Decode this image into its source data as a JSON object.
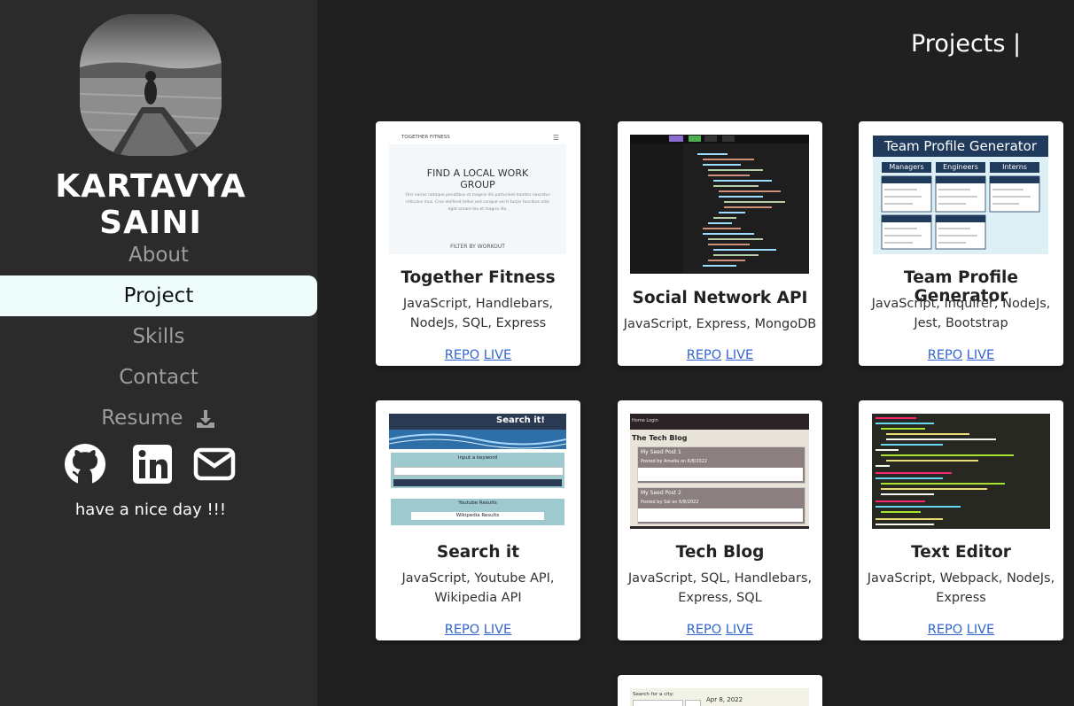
{
  "profile": {
    "name": "KARTAVYA SAINI",
    "tagline": "have a nice day !!!"
  },
  "nav": {
    "items": [
      "About",
      "Project",
      "Skills",
      "Contact",
      "Resume"
    ],
    "active_index": 1
  },
  "socials": [
    "github-icon",
    "linkedin-icon",
    "email-icon"
  ],
  "page": {
    "title": "Projects |"
  },
  "projects": [
    {
      "title": "Together Fitness",
      "tech": "JavaScript, Handlebars, NodeJs, SQL, Express",
      "repo": "REPO",
      "live": "LIVE",
      "thumb": {
        "brand": "TOGETHER FITNESS",
        "heading": "FIND A LOCAL WORK GROUP",
        "body": "Orci varius natoque penatibus et magnis dis parturient montes nascetur ridiculus mus. Cras eleifend tellus sed congue vel it turpis faucibus odio eget ornare leo et magna illa.",
        "footer": "FILTER BY WORKOUT"
      }
    },
    {
      "title": "Social Network API",
      "tech": "JavaScript, Express, MongoDB",
      "repo": "REPO",
      "live": "LIVE"
    },
    {
      "title": "Team Profile Generator",
      "tech": "JavaScript, Inquirer, NodeJs, Jest, Bootstrap",
      "repo": "REPO",
      "live": "LIVE",
      "thumb": {
        "header": "Team Profile Generator",
        "columns": [
          "Managers",
          "Engineers",
          "Interns"
        ]
      }
    },
    {
      "title": "Search it",
      "tech": "JavaScript, Youtube API, Wikipedia API",
      "repo": "REPO",
      "live": "LIVE",
      "thumb": {
        "header": "Search it!",
        "input_label": "Input a keyword",
        "youtube": "Youtube Results",
        "wiki": "Wikipedia Results"
      }
    },
    {
      "title": "Tech Blog",
      "tech": "JavaScript, SQL, Handlebars, Express, SQL",
      "repo": "REPO",
      "live": "LIVE",
      "thumb": {
        "nav": "Home  Login",
        "heading": "The Tech Blog",
        "post1": "My Seed Post 1",
        "post1_by": "Posted by Amelia on 6/8/2022",
        "post2": "My Seed Post 2",
        "post2_by": "Posted by Sal on 6/8/2022"
      }
    },
    {
      "title": "Text Editor",
      "tech": "JavaScript, Webpack, NodeJs, Express",
      "repo": "REPO",
      "live": "LIVE"
    },
    {
      "thumb": {
        "search": "Search for a city:",
        "date": "Apr 8, 2022"
      }
    }
  ],
  "colors": {
    "sidebar_bg": "#2b2b2b",
    "page_bg": "#202020",
    "active_nav_bg": "#eefdfb",
    "link": "#3366cc",
    "team_header": "#1f3a5a"
  }
}
